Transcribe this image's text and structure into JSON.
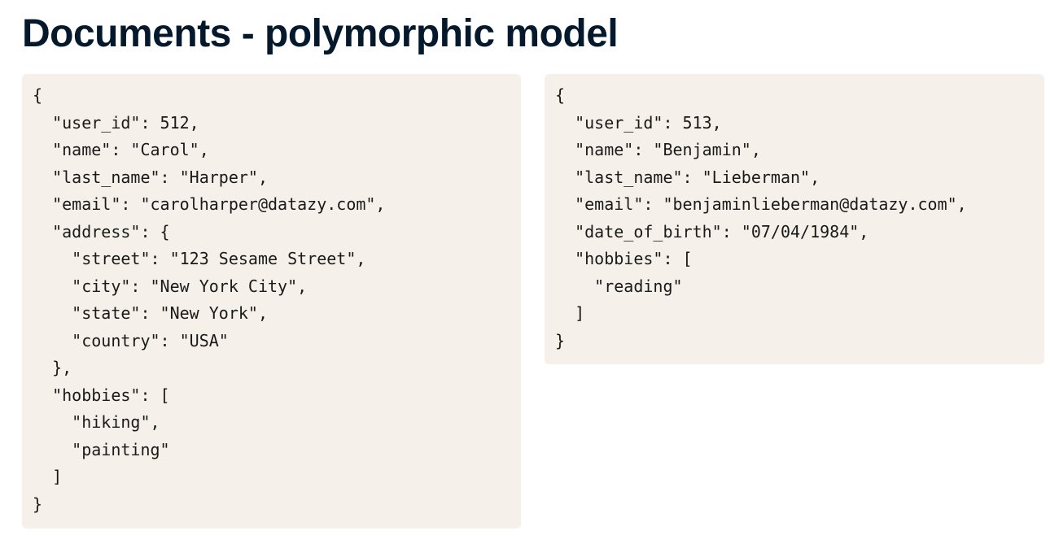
{
  "title": "Documents - polymorphic model",
  "documents": [
    {
      "code": "{\n  \"user_id\": 512,\n  \"name\": \"Carol\",\n  \"last_name\": \"Harper\",\n  \"email\": \"carolharper@datazy.com\",\n  \"address\": {\n    \"street\": \"123 Sesame Street\",\n    \"city\": \"New York City\",\n    \"state\": \"New York\",\n    \"country\": \"USA\"\n  },\n  \"hobbies\": [\n    \"hiking\",\n    \"painting\"\n  ]\n}"
    },
    {
      "code": "{\n  \"user_id\": 513,\n  \"name\": \"Benjamin\",\n  \"last_name\": \"Lieberman\",\n  \"email\": \"benjaminlieberman@datazy.com\",\n  \"date_of_birth\": \"07/04/1984\",\n  \"hobbies\": [\n    \"reading\"\n  ]\n}"
    }
  ]
}
